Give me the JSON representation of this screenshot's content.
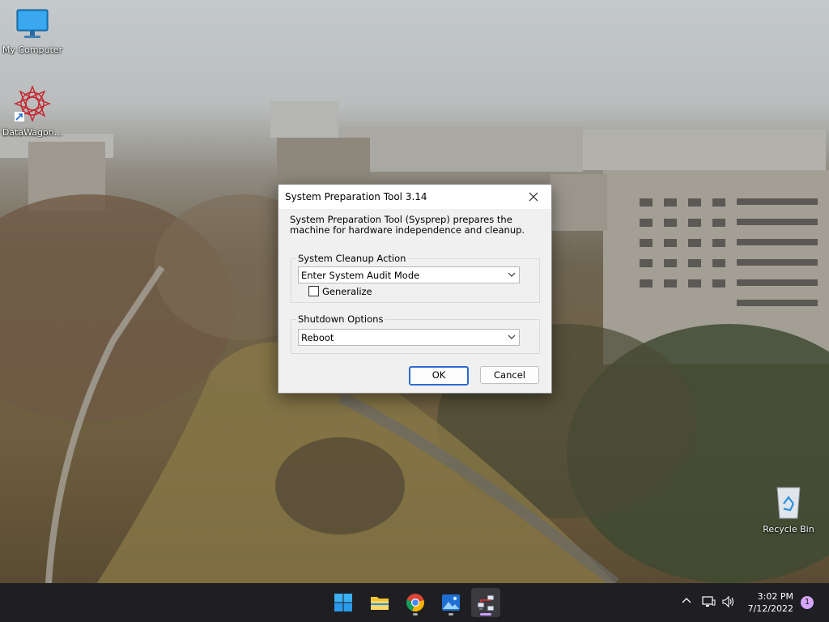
{
  "desktop": {
    "icons": [
      {
        "label": "My Computer"
      },
      {
        "label": "DataWagon..."
      },
      {
        "label": "Recycle Bin"
      }
    ]
  },
  "dialog": {
    "title": "System Preparation Tool 3.14",
    "description": "System Preparation Tool (Sysprep) prepares the machine for hardware independence and cleanup.",
    "cleanup": {
      "legend": "System Cleanup Action",
      "selected": "Enter System Audit Mode",
      "generalize_label": "Generalize",
      "generalize_checked": false
    },
    "shutdown": {
      "legend": "Shutdown Options",
      "selected": "Reboot"
    },
    "ok_label": "OK",
    "cancel_label": "Cancel"
  },
  "taskbar": {
    "apps": [
      "windows-start",
      "file-explorer",
      "chrome",
      "photos",
      "sysprep"
    ],
    "time": "3:02 PM",
    "date": "7/12/2022",
    "notification_count": "1"
  }
}
